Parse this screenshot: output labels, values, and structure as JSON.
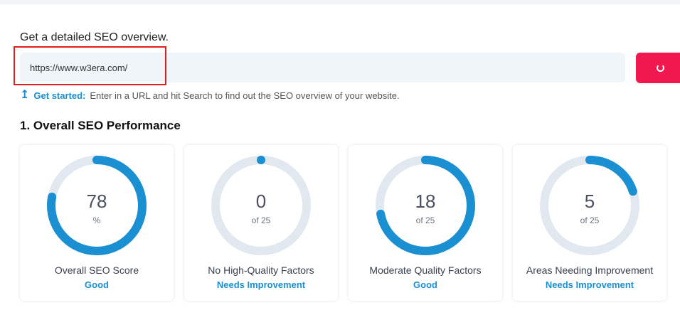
{
  "intro_text": "Get a detailed SEO overview.",
  "search": {
    "value": "https://www.w3era.com/",
    "button_icon": "loading-spinner-icon"
  },
  "hint": {
    "icon": "arrow-up-icon",
    "label": "Get started:",
    "text": "Enter in a URL and hit Search to find out the SEO overview of your website."
  },
  "section_title": "1. Overall SEO Performance",
  "colors": {
    "accent": "#1a8fd1",
    "ring_track": "#e2e8f0",
    "button": "#f0184e"
  },
  "cards": [
    {
      "value": "78",
      "unit": "%",
      "fraction": 0.78,
      "label": "Overall SEO Score",
      "status": "Good"
    },
    {
      "value": "0",
      "unit": "of 25",
      "fraction": 0.0,
      "label": "No High-Quality Factors",
      "status": "Needs Improvement"
    },
    {
      "value": "18",
      "unit": "of 25",
      "fraction": 0.72,
      "label": "Moderate Quality Factors",
      "status": "Good"
    },
    {
      "value": "5",
      "unit": "of 25",
      "fraction": 0.2,
      "label": "Areas Needing Improvement",
      "status": "Needs Improvement"
    }
  ]
}
